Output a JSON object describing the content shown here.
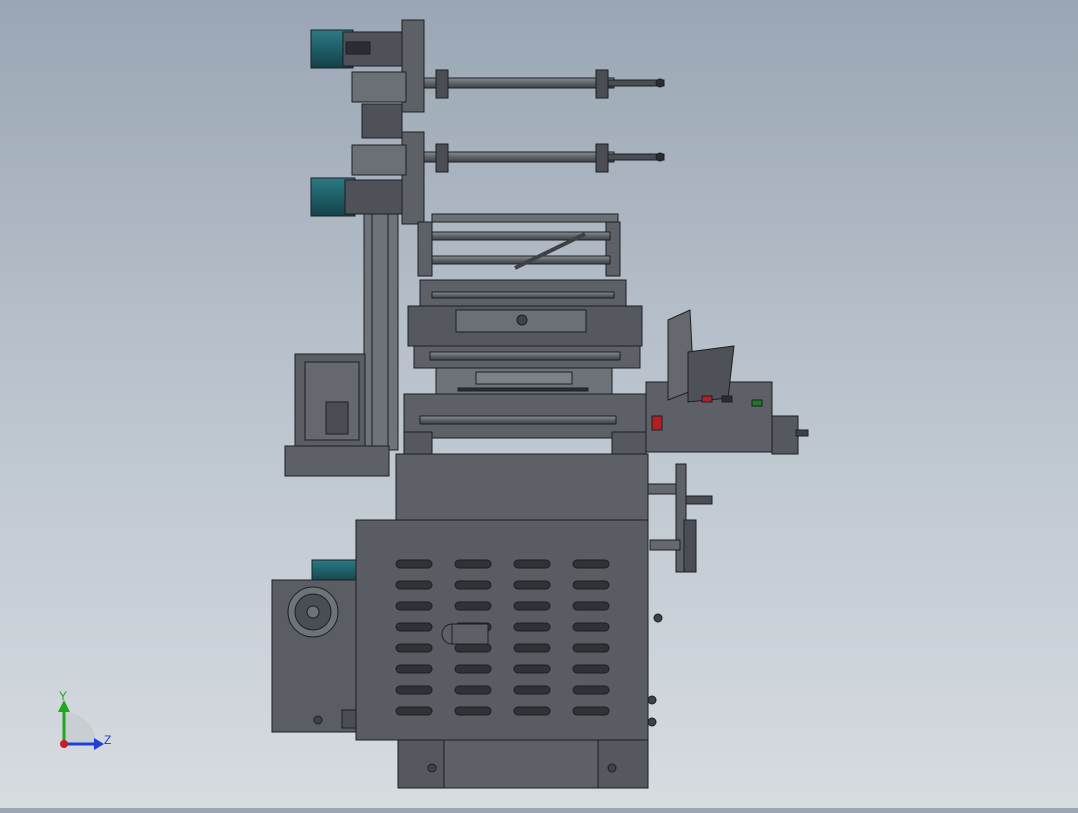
{
  "viewport": {
    "view_orientation": "front",
    "background_top": "#9aa6b4",
    "background_bottom": "#d7dce1"
  },
  "model": {
    "body_color": "#5d6167",
    "edge_color": "#1c1f23",
    "motor_color": "#1f5e66"
  },
  "triad": {
    "y_label": "Y",
    "z_label": "Z",
    "y_color": "#1ea81e",
    "z_color": "#1f3fd6",
    "x_color": "#c81e1e"
  }
}
